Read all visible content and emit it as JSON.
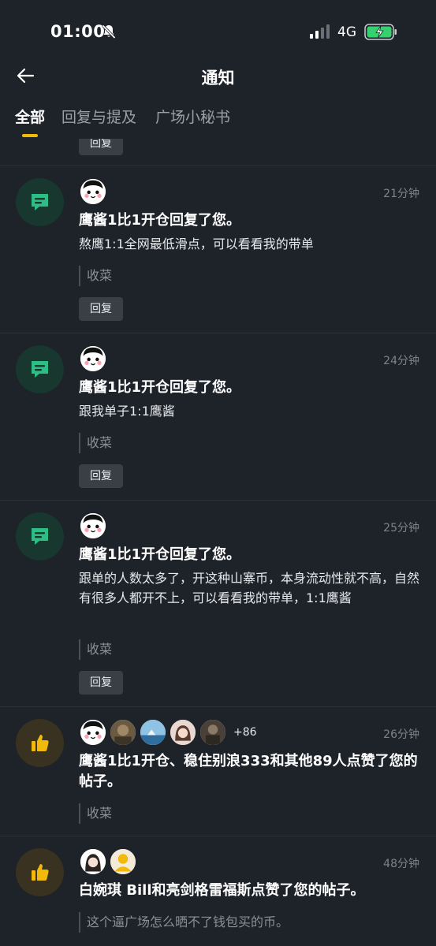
{
  "status_bar": {
    "time": "01:00",
    "network": "4G"
  },
  "header": {
    "title": "通知"
  },
  "tabs": [
    {
      "label": "全部"
    },
    {
      "label": "回复与提及"
    },
    {
      "label": "广场小秘书"
    }
  ],
  "colors": {
    "accent": "#f0b90b",
    "comment_icon": "#2ebd85",
    "like_icon": "#f0b90b"
  },
  "notifications": [
    {
      "type": "comment",
      "reply_label": "回复"
    },
    {
      "type": "comment",
      "time": "21分钟",
      "headline": "鹰酱1比1开仓回复了您。",
      "body": "熬鹰1:1全网最低滑点，可以看看我的带单",
      "quote": "收菜",
      "reply_label": "回复"
    },
    {
      "type": "comment",
      "time": "24分钟",
      "headline": "鹰酱1比1开仓回复了您。",
      "body": "跟我单子1:1鹰酱",
      "quote": "收菜",
      "reply_label": "回复"
    },
    {
      "type": "comment",
      "time": "25分钟",
      "headline": "鹰酱1比1开仓回复了您。",
      "body": "跟单的人数太多了，开这种山寨币，本身流动性就不高，自然有很多人都开不上，可以看看我的带单，1:1鹰酱",
      "quote": "收菜",
      "reply_label": "回复"
    },
    {
      "type": "like",
      "time": "26分钟",
      "more_count": "+86",
      "headline": "鹰酱1比1开仓、稳住别浪333和其他89人点赞了您的帖子。",
      "quote": "收菜"
    },
    {
      "type": "like",
      "time": "48分钟",
      "headline": "白婉琪 Bill和亮剑格雷福斯点赞了您的帖子。",
      "quote": "这个逼广场怎么晒不了钱包买的币。"
    }
  ]
}
